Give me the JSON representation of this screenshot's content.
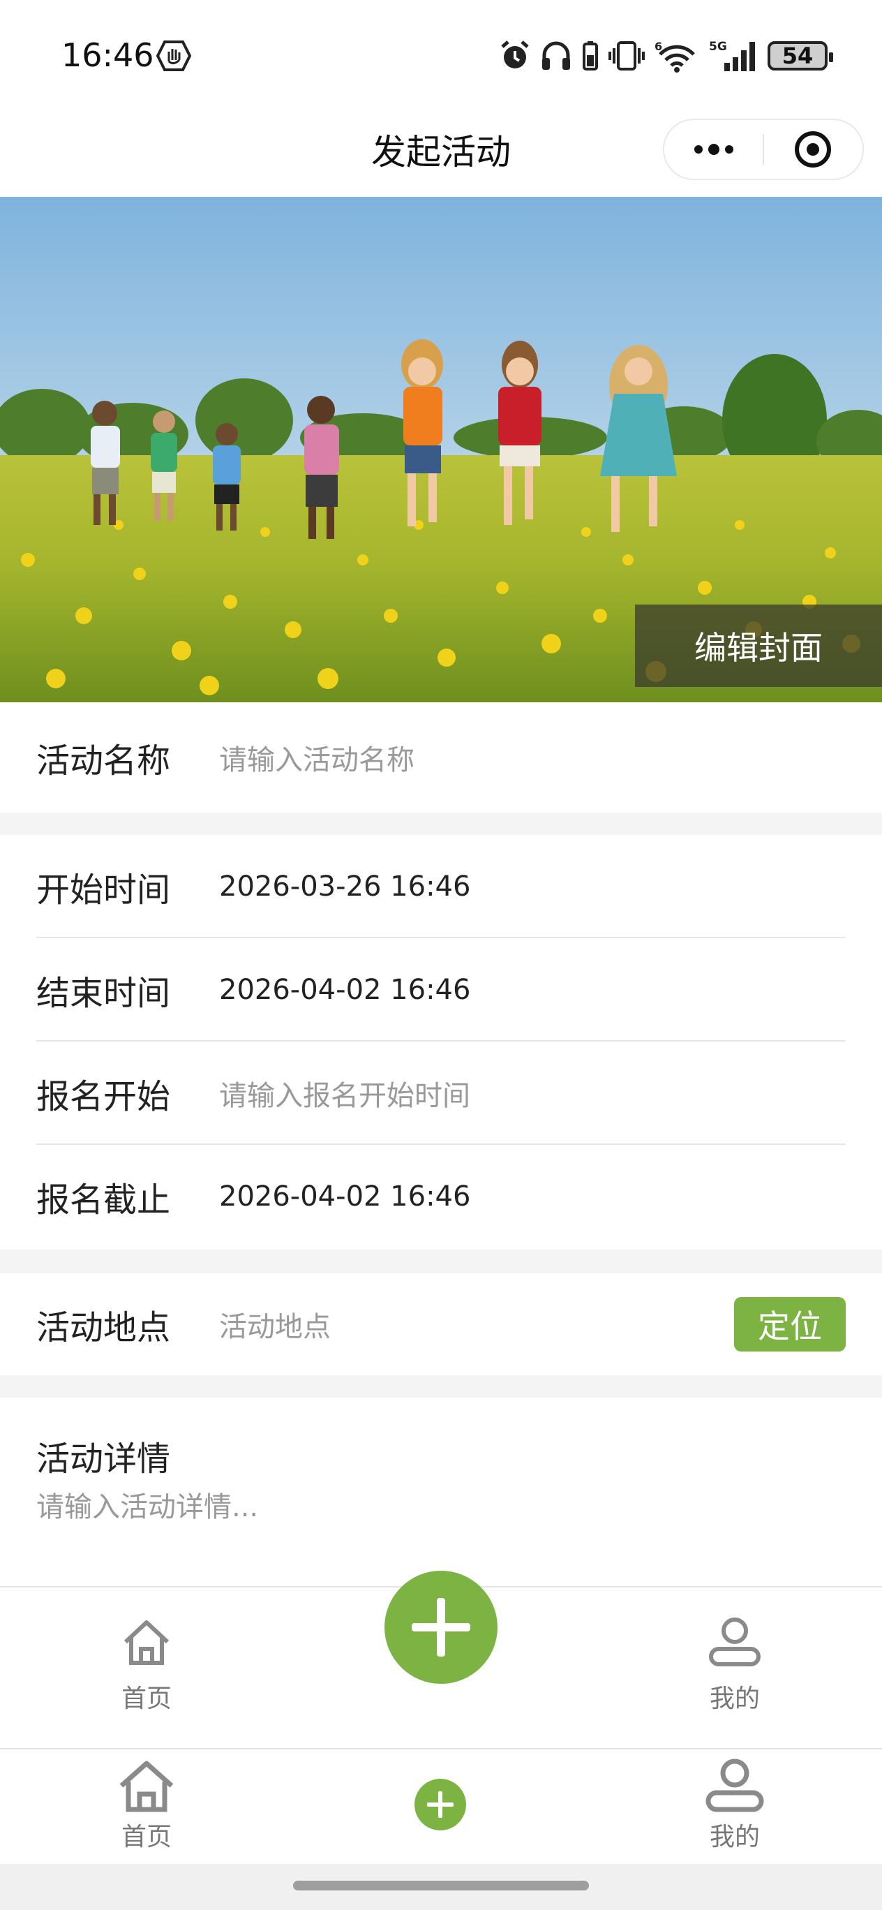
{
  "status_bar": {
    "time": "16:46",
    "battery": "54",
    "icons": [
      "hand-badge-icon",
      "alarm-icon",
      "headphones-icon",
      "battery-small-icon",
      "vibrate-icon",
      "wifi-icon",
      "signal-5g-icon"
    ]
  },
  "header": {
    "title": "发起活动",
    "capsule_icons": [
      "more-dots-icon",
      "target-icon"
    ]
  },
  "cover": {
    "edit_label": "编辑封面"
  },
  "form": {
    "name": {
      "label": "活动名称",
      "placeholder": "请输入活动名称"
    },
    "start_time": {
      "label": "开始时间",
      "value": "2026-03-26 16:46"
    },
    "end_time": {
      "label": "结束时间",
      "value": "2026-04-02 16:46"
    },
    "signup_start": {
      "label": "报名开始",
      "placeholder": "请输入报名开始时间"
    },
    "signup_end": {
      "label": "报名截止",
      "value": "2026-04-02 16:46"
    },
    "location": {
      "label": "活动地点",
      "placeholder": "活动地点",
      "button": "定位"
    },
    "details": {
      "label": "活动详情",
      "placeholder": "请输入活动详情..."
    }
  },
  "tabbar": {
    "home": "首页",
    "mine": "我的",
    "add_icon": "plus-icon"
  },
  "colors": {
    "accent_green": "#7cb342",
    "placeholder_gray": "#999999"
  }
}
